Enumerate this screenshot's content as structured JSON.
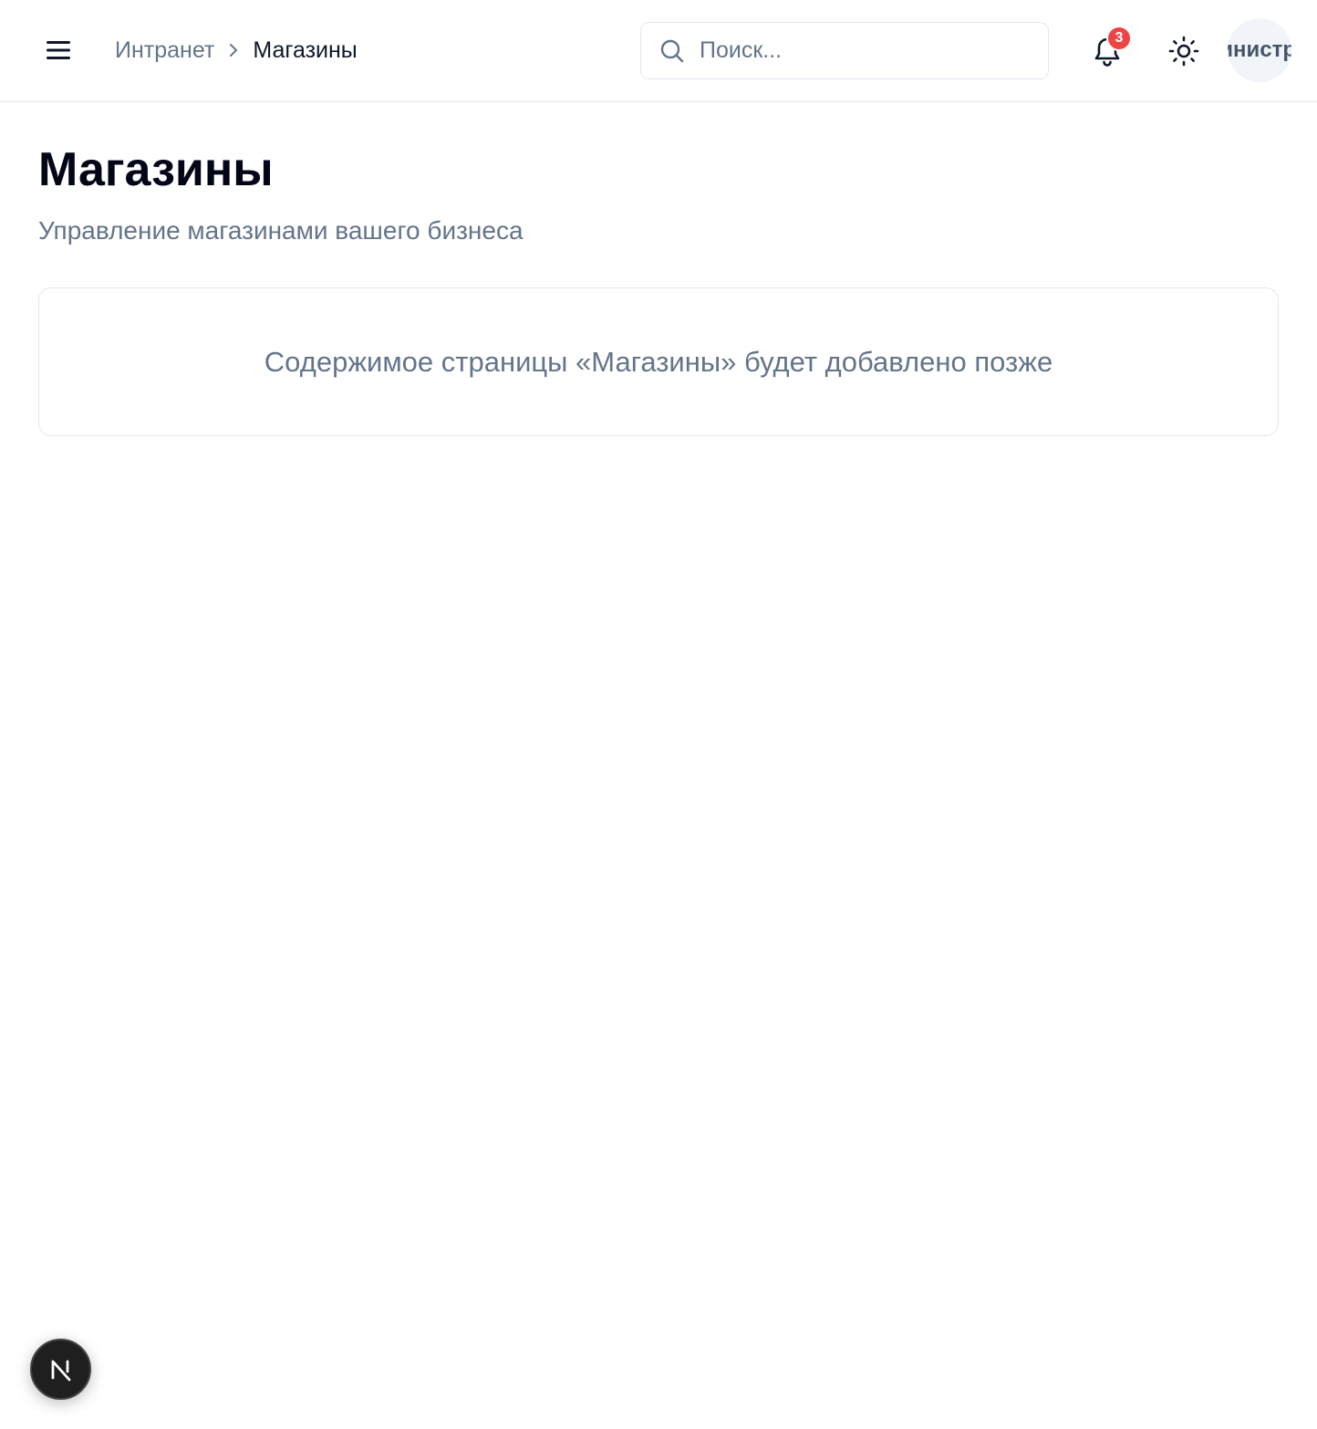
{
  "header": {
    "breadcrumb": {
      "root": "Интранет",
      "current": "Магазины"
    },
    "search": {
      "placeholder": "Поиск..."
    },
    "notifications": {
      "count": "3"
    },
    "avatar": {
      "label": "Администратор"
    }
  },
  "main": {
    "title": "Магазины",
    "subtitle": "Управление магазинами вашего бизнеса",
    "placeholder_text": "Содержимое страницы «Магазины» будет добавлено позже"
  },
  "floating": {
    "badge_letter": "N"
  },
  "icons": {
    "menu": "hamburger-icon",
    "separator": "chevron-right-icon",
    "search": "search-icon",
    "notifications": "bell-icon",
    "theme": "sun-icon"
  },
  "colors": {
    "badge": "#ef4444",
    "muted_text": "#64748b",
    "border": "#e2e8f0"
  }
}
